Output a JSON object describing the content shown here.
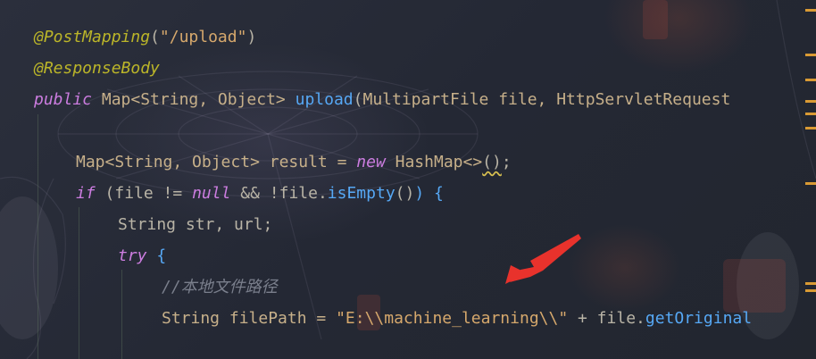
{
  "code": {
    "line1": {
      "annotation": "@PostMapping",
      "open": "(",
      "string": "\"/upload\"",
      "close": ")"
    },
    "line2": {
      "annotation": "@ResponseBody"
    },
    "line3": {
      "kw": "public",
      "sig_a": " Map<String, Object> ",
      "method": "upload",
      "open": "(",
      "params": "MultipartFile file, HttpServletRequest"
    },
    "line4": {},
    "line5": {
      "text_a": "Map<String, Object> result = ",
      "kw": "new",
      "text_b": " HashMap<>",
      "paren": "()",
      "semi": ";"
    },
    "line6": {
      "kw_if": "if",
      "text_a": " (file != ",
      "kw_null": "null",
      "text_b": " && !file.",
      "method": "isEmpty",
      "call": "()",
      "close": ") {"
    },
    "line7": {
      "text": "String str, url;"
    },
    "line8": {
      "kw": "try",
      "brace": " {"
    },
    "line9": {
      "comment": "//本地文件路径"
    },
    "line10": {
      "text_a": "String filePath = ",
      "string": "\"E:\\\\machine_learning\\\\\"",
      "text_b": " + file.",
      "method": "getOriginal"
    }
  },
  "colors": {
    "annotation": "#bbb529",
    "keyword": "#cc7de0",
    "method": "#56a8f5",
    "string": "#d6a86c",
    "comment": "#7a7f8c",
    "arrow": "#e8322c",
    "marker": "#d99a34"
  }
}
